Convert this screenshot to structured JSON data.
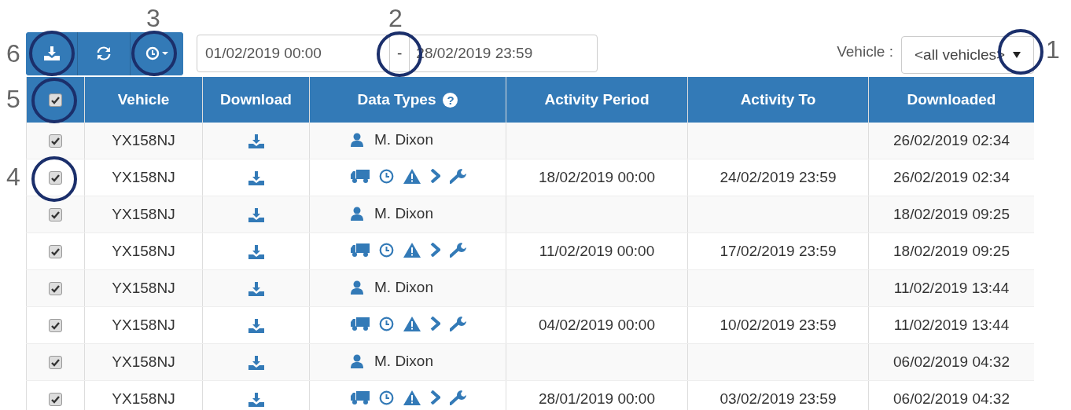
{
  "date_range": {
    "from": "01/02/2019 00:00",
    "separator": "-",
    "to": "28/02/2019 23:59"
  },
  "vehicle_filter": {
    "label": "Vehicle :",
    "value": "<all vehicles>"
  },
  "table": {
    "header_checked": true,
    "help_mark": "?",
    "columns": [
      "Vehicle",
      "Download",
      "Data Types",
      "Activity Period",
      "Activity To",
      "Downloaded"
    ],
    "rows": [
      {
        "checked": true,
        "vehicle": "YX158NJ",
        "kind": "driver",
        "driver": "M. Dixon",
        "downloaded": "26/02/2019 02:34"
      },
      {
        "checked": true,
        "vehicle": "YX158NJ",
        "kind": "vehicle",
        "activity_period": "18/02/2019 00:00",
        "activity_to": "24/02/2019 23:59",
        "downloaded": "26/02/2019 02:34"
      },
      {
        "checked": true,
        "vehicle": "YX158NJ",
        "kind": "driver",
        "driver": "M. Dixon",
        "downloaded": "18/02/2019 09:25"
      },
      {
        "checked": true,
        "vehicle": "YX158NJ",
        "kind": "vehicle",
        "activity_period": "11/02/2019 00:00",
        "activity_to": "17/02/2019 23:59",
        "downloaded": "18/02/2019 09:25"
      },
      {
        "checked": true,
        "vehicle": "YX158NJ",
        "kind": "driver",
        "driver": "M. Dixon",
        "downloaded": "11/02/2019 13:44"
      },
      {
        "checked": true,
        "vehicle": "YX158NJ",
        "kind": "vehicle",
        "activity_period": "04/02/2019 00:00",
        "activity_to": "10/02/2019 23:59",
        "downloaded": "11/02/2019 13:44"
      },
      {
        "checked": true,
        "vehicle": "YX158NJ",
        "kind": "driver",
        "driver": "M. Dixon",
        "downloaded": "06/02/2019 04:32"
      },
      {
        "checked": true,
        "vehicle": "YX158NJ",
        "kind": "vehicle",
        "activity_period": "28/01/2019 00:00",
        "activity_to": "03/02/2019 23:59",
        "downloaded": "06/02/2019 04:32"
      }
    ]
  },
  "callouts": [
    {
      "label": "3"
    },
    {
      "label": "2"
    },
    {
      "label": "6"
    },
    {
      "label": "1"
    },
    {
      "label": "5"
    },
    {
      "label": "4"
    }
  ]
}
